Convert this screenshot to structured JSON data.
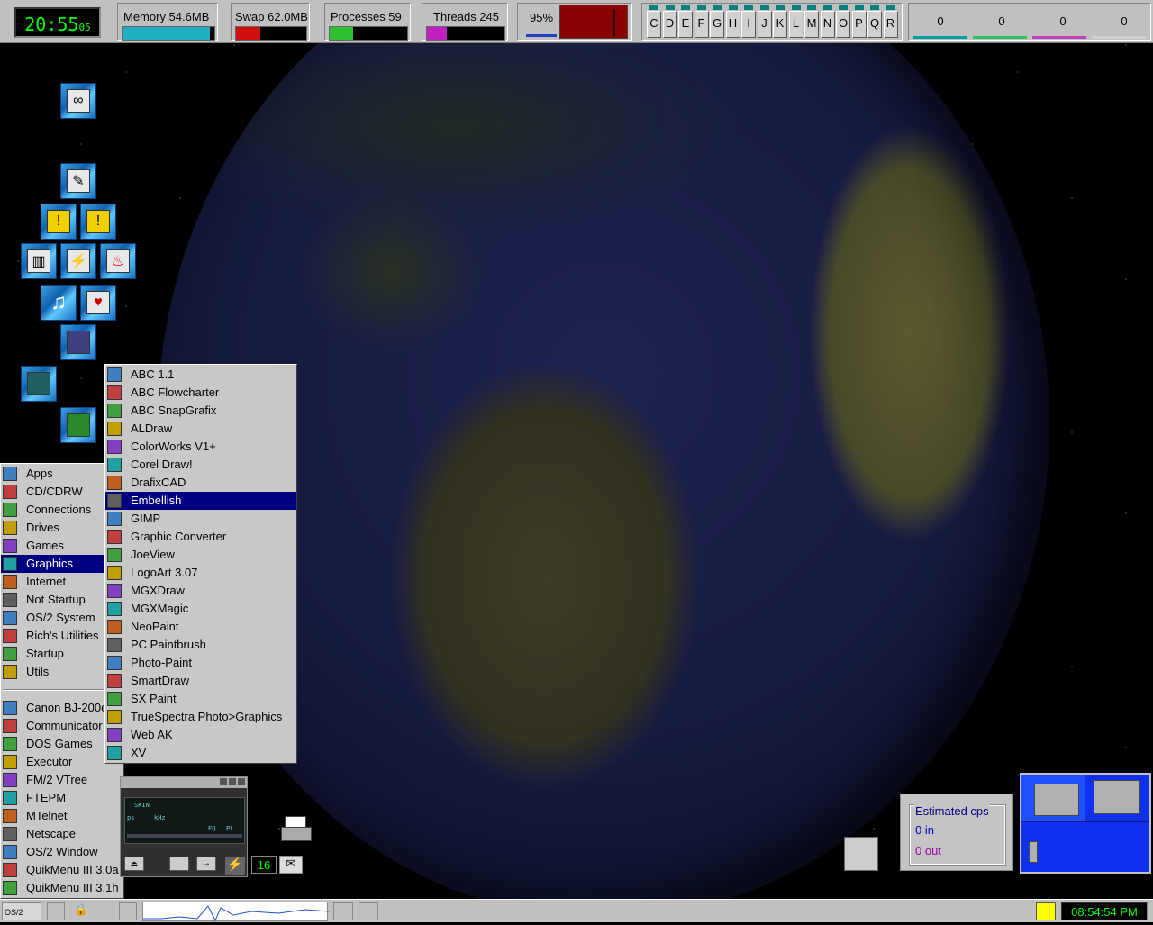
{
  "topbar": {
    "clock": "20:55",
    "clock_seconds": "05",
    "memory_label": "Memory 54.6MB",
    "memory_fill": 0.95,
    "swap_label": "Swap 62.0MB",
    "swap_fill": 0.35,
    "processes_label": "Processes 59",
    "processes_fill": 0.3,
    "threads_label": "Threads 245",
    "threads_fill": 0.25,
    "cpu_percent": "95%",
    "drives": [
      "C",
      "D",
      "E",
      "F",
      "G",
      "H",
      "I",
      "J",
      "K",
      "L",
      "M",
      "N",
      "O",
      "P",
      "Q",
      "R"
    ],
    "net_values": [
      "0",
      "0",
      "0",
      "0"
    ],
    "net_colors": [
      "#00a0a0",
      "#30c060",
      "#c040c0",
      "#d0d0d0"
    ]
  },
  "apps_menu": {
    "items": [
      "Apps",
      "CD/CDRW",
      "Connections",
      "Drives",
      "Games",
      "Graphics",
      "Internet",
      "Not Startup",
      "OS/2 System",
      "Rich's Utilities",
      "Startup",
      "Utils"
    ],
    "selected_index": 5,
    "items2": [
      "Canon BJ-200e",
      "Communicator",
      "DOS Games",
      "Executor",
      "FM/2 VTree",
      "FTEPM",
      "MTelnet",
      "Netscape",
      "OS/2 Window",
      "QuikMenu III  3.0a",
      "QuikMenu III  3.1h"
    ]
  },
  "graphics_menu": {
    "items": [
      "ABC 1.1",
      "ABC Flowcharter",
      "ABC SnapGrafix",
      "ALDraw",
      "ColorWorks V1+",
      "Corel Draw!",
      "DrafixCAD",
      "Embellish",
      "GIMP",
      "Graphic Converter",
      "JoeView",
      "LogoArt 3.07",
      "MGXDraw",
      "MGXMagic",
      "NeoPaint",
      "PC Paintbrush",
      "Photo-Paint",
      "SmartDraw",
      "SX Paint",
      "TrueSpectra  Photo>Graphics",
      "Web AK",
      "XV"
    ],
    "selected_index": 7
  },
  "player": {
    "screen_text": "SKIN",
    "kbps": "ps",
    "khz": "kHz",
    "eq": "EQ",
    "pl": "PL",
    "counter": "16"
  },
  "cps_box": {
    "title": "Estimated cps",
    "in": "0 in",
    "out": "0 out"
  },
  "taskbar": {
    "logo": "OS/2",
    "clock": "08:54:54 PM"
  }
}
